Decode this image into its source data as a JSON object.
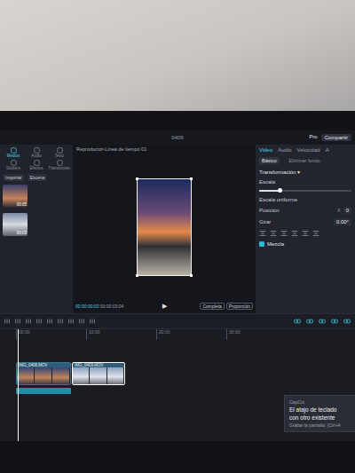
{
  "app": {
    "title": "0409",
    "pro": "Pro",
    "share": "Compartir"
  },
  "media_tabs": [
    {
      "label": "Medios",
      "selected": true
    },
    {
      "label": "Audio",
      "selected": false
    },
    {
      "label": "Texto",
      "selected": false
    },
    {
      "label": "Stickers",
      "selected": false
    },
    {
      "label": "Efectos",
      "selected": false
    },
    {
      "label": "Transiciones",
      "selected": false
    }
  ],
  "media": {
    "import": "Importar",
    "scene": "Escena",
    "items": [
      {
        "duration": "00:05"
      },
      {
        "duration": "00:03"
      }
    ]
  },
  "player": {
    "title": "Reproductor-Línea de tiempo 01",
    "current": "00:00:00:00",
    "total": "00:00:03:04",
    "play": "▶",
    "full": "Completa",
    "ratio": "Proporción"
  },
  "inspector": {
    "tabs": [
      {
        "label": "Video",
        "selected": true
      },
      {
        "label": "Audio",
        "selected": false
      },
      {
        "label": "Velocidad",
        "selected": false
      },
      {
        "label": "A",
        "selected": false
      }
    ],
    "subtabs": [
      {
        "label": "Básico",
        "selected": true
      },
      {
        "label": "Eliminar fondo",
        "selected": false
      }
    ],
    "section": "Transformación",
    "scale": {
      "label": "Escala",
      "level": 0.22
    },
    "uniform": "Escala uniforme",
    "position": {
      "label": "Posición",
      "axis": "X",
      "value": "0"
    },
    "rotate": {
      "label": "Girar",
      "value": "0.00°"
    },
    "blend": {
      "label": "Mezcla",
      "on": true
    }
  },
  "timeline": {
    "ruler": [
      "00:00",
      "10:00",
      "20:00",
      "30:00"
    ],
    "clips": [
      {
        "label": "IMG_0408.MOV",
        "selected": false
      },
      {
        "label": "IMG_0409.MOV",
        "selected": true
      }
    ]
  },
  "toast": {
    "app": "CapCut",
    "lines": [
      "El atajo de teclado",
      "con otro existente"
    ],
    "hint": "Grabar la pantalla: [Ctrl+A"
  }
}
